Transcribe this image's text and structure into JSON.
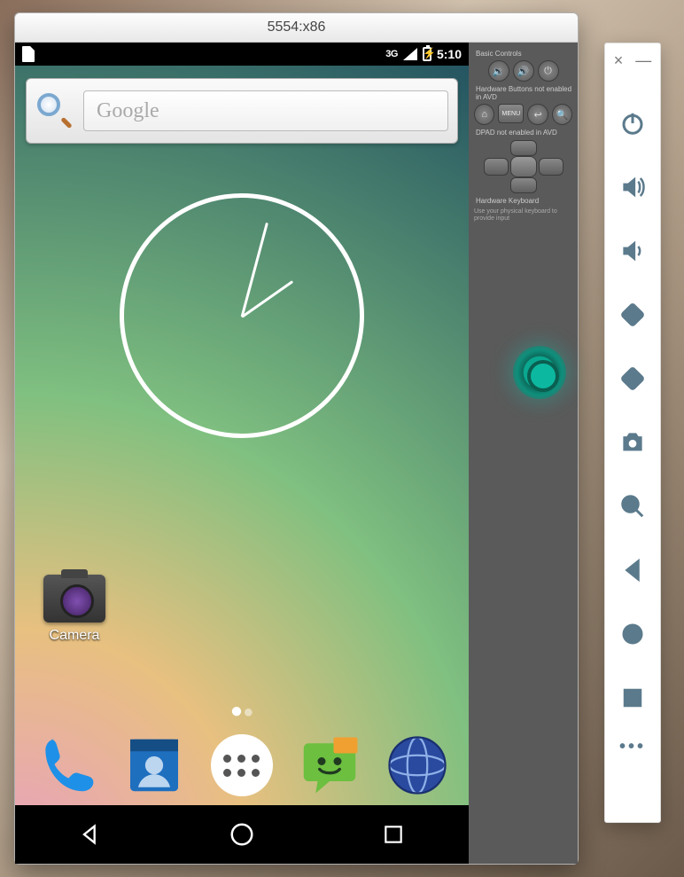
{
  "emulator": {
    "window_title": "5554:x86",
    "statusbar": {
      "network": "3G",
      "time": "5:10"
    },
    "search": {
      "placeholder": "Google"
    },
    "camera_label": "Camera",
    "legacy": {
      "basic_controls": "Basic Controls",
      "hw_buttons": "Hardware Buttons not enabled in AVD",
      "menu_label": "MENU",
      "dpad": "DPAD not enabled in AVD",
      "hw_keyboard_title": "Hardware Keyboard",
      "hw_keyboard_note": "Use your physical keyboard to provide input"
    }
  },
  "toolbar": {
    "close": "×",
    "minimize": "—",
    "more": "•••"
  }
}
